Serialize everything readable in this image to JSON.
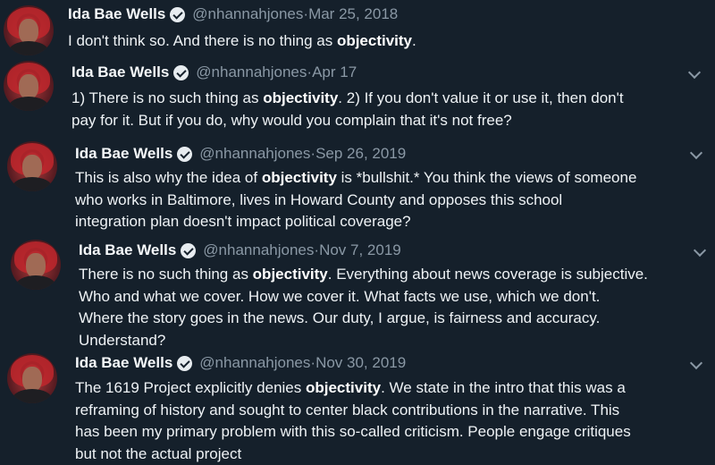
{
  "tweets": [
    {
      "name": "Ida Bae Wells",
      "handle": "@nhannahjones",
      "date": "Mar 25, 2018",
      "text_before": "I don't think so. And there is no thing as ",
      "keyword": "objectivity",
      "text_after": "."
    },
    {
      "name": "Ida Bae Wells",
      "handle": "@nhannahjones",
      "date": "Apr 17",
      "text_before": "1) There is no such thing as ",
      "keyword": "objectivity",
      "text_after": ". 2) If you don't value it or use it, then don't\npay for it. But if you do, why would you complain that it's not free?"
    },
    {
      "name": "Ida Bae Wells",
      "handle": "@nhannahjones",
      "date": "Sep 26, 2019",
      "text_before": "This is also why the idea of ",
      "keyword": "objectivity",
      "text_after": " is *bullshit.* You think the views of someone\nwho works in Baltimore, lives in Howard County and opposes this school\nintegration plan doesn't impact political coverage?"
    },
    {
      "name": "Ida Bae Wells",
      "handle": "@nhannahjones",
      "date": "Nov 7, 2019",
      "text_before": "There is no such thing as ",
      "keyword": "objectivity",
      "text_after": ". Everything about news coverage is subjective.\nWho and what we cover. How we cover it. What facts we use, which we don't.\nWhere the story goes in the news. Our duty, I argue, is fairness and accuracy.\nUnderstand?"
    },
    {
      "name": "Ida Bae Wells",
      "handle": "@nhannahjones",
      "date": "Nov 30, 2019",
      "text_before": "The 1619 Project explicitly denies ",
      "keyword": "objectivity",
      "text_after": ". We state in the intro that this was a\nreframing of history and sought to center black contributions in the narrative. This\nhas been my primary problem with this so-called criticism. People engage critiques\nbut not the actual project"
    }
  ],
  "separator": " · "
}
